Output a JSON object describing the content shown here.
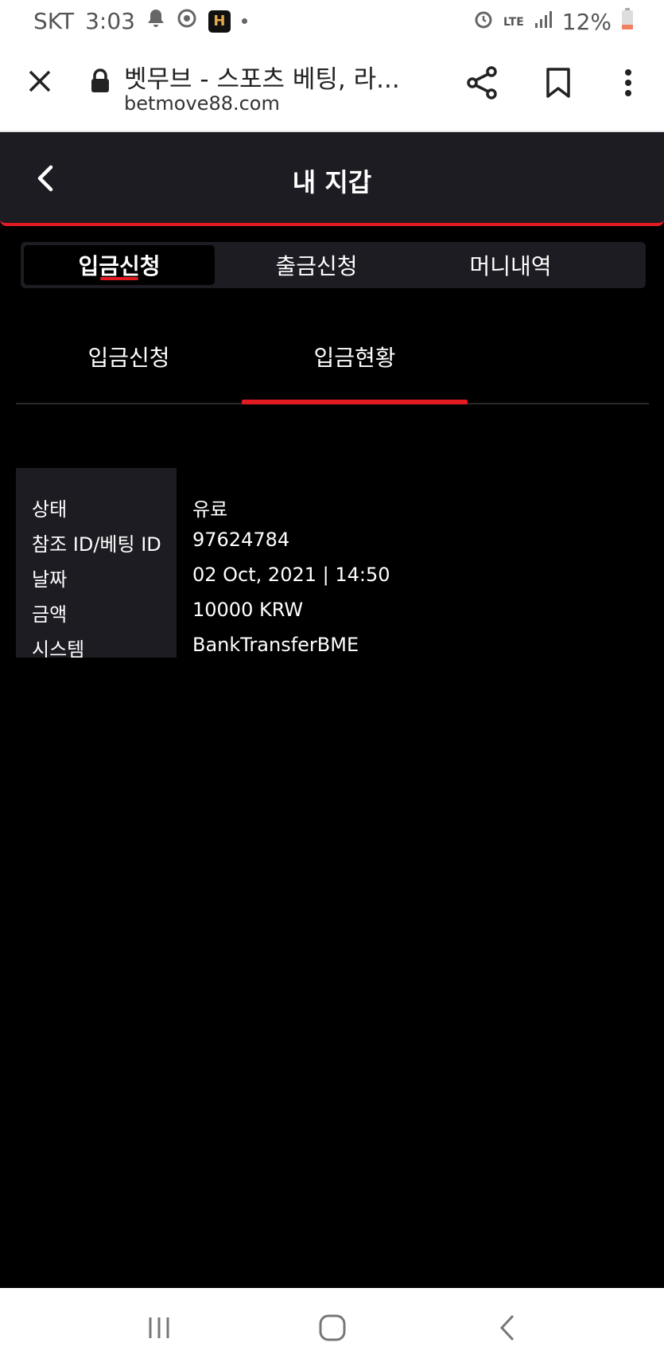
{
  "status_bar": {
    "carrier": "SKT",
    "time": "3:03",
    "app_badge": "H",
    "network": "LTE",
    "battery": "12%"
  },
  "browser": {
    "page_title": "벳무브 - 스포츠 베팅, 라...",
    "domain": "betmove88.com"
  },
  "header": {
    "title": "내 지갑"
  },
  "main_tabs": [
    {
      "label": "입금신청"
    },
    {
      "label": "출금신청"
    },
    {
      "label": "머니내역"
    }
  ],
  "sub_tabs": [
    {
      "label": "입금신청"
    },
    {
      "label": "입금현황"
    }
  ],
  "details": [
    {
      "label": "상태",
      "value": "유료"
    },
    {
      "label": "참조 ID/베팅 ID",
      "value": "97624784"
    },
    {
      "label": "날짜",
      "value": "02 Oct, 2021 | 14:50"
    },
    {
      "label": "금액",
      "value": "10000 KRW"
    },
    {
      "label": "시스템",
      "value": "BankTransferBME"
    }
  ],
  "colors": {
    "accent": "#e21b23",
    "panel": "#1c1c22",
    "background": "#000000"
  }
}
